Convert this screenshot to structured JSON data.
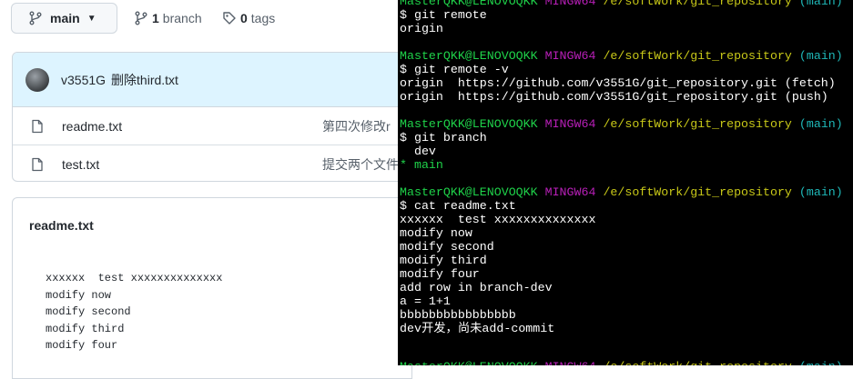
{
  "github": {
    "branch_button": {
      "label": "main"
    },
    "branches": {
      "count": "1",
      "label": "branch"
    },
    "tags": {
      "count": "0",
      "label": "tags"
    },
    "latest_commit": {
      "author": "v3551G",
      "message": "删除third.txt"
    },
    "files": [
      {
        "name": "readme.txt",
        "commit": "第四次修改r"
      },
      {
        "name": "test.txt",
        "commit": "提交两个文件"
      }
    ],
    "readme": {
      "title": "readme.txt",
      "lines": [
        "xxxxxx  test xxxxxxxxxxxxxx",
        "modify now",
        "modify second",
        "modify third",
        "modify four"
      ]
    }
  },
  "terminal": {
    "prompt": {
      "user": "MasterQKK@LENOVOQKK",
      "shell": "MINGW64",
      "path": "/e/softWork/git_repository",
      "branch": "(main)"
    },
    "cmd1": "$ git remote",
    "out1": "origin",
    "cmd2": "$ git remote -v",
    "out2a": "origin  https://github.com/v3551G/git_repository.git (fetch)",
    "out2b": "origin  https://github.com/v3551G/git_repository.git (push)",
    "cmd3": "$ git branch",
    "out3a": "  dev",
    "out3b": "* main",
    "cmd4": "$ cat readme.txt",
    "cat_lines": [
      "xxxxxx  test xxxxxxxxxxxxxx",
      "modify now",
      "modify second",
      "modify third",
      "modify four",
      "add row in branch-dev",
      "a = 1+1",
      "bbbbbbbbbbbbbbbb",
      "dev开发，尚未add-commit"
    ]
  }
}
